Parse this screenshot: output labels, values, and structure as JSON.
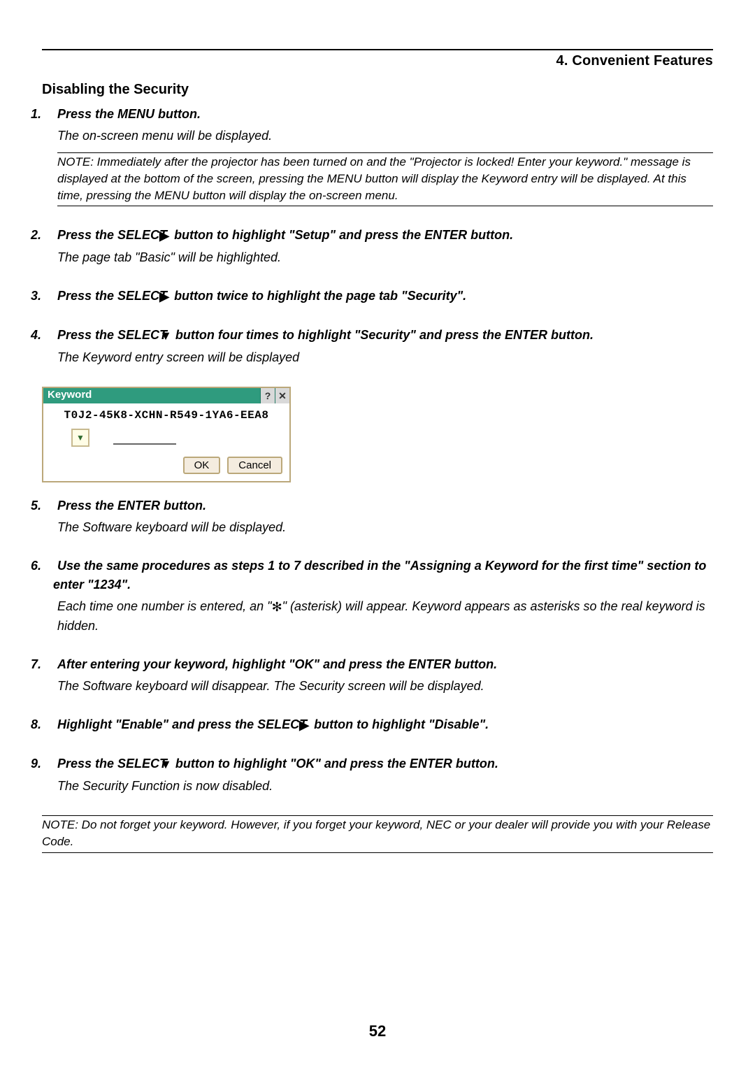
{
  "chapter": "4. Convenient Features",
  "section_title": "Disabling the Security",
  "glyphs": {
    "right": "▶",
    "down": "▼",
    "asterisk": "✻"
  },
  "steps": [
    {
      "num": "1.",
      "heading": "Press the MENU button.",
      "desc": "The on-screen menu will be displayed.",
      "note": "NOTE: Immediately after the projector has been turned on and the \"Projector is locked! Enter your keyword.\" message is displayed at the bottom of the screen, pressing the MENU button will display the Keyword entry will be displayed. At this time, pressing the MENU button will display the on-screen menu."
    },
    {
      "num": "2.",
      "heading_pre": "Press the SELECT ",
      "heading_glyph": "right",
      "heading_post": " button to highlight \"Setup\" and press the ENTER button.",
      "desc": "The page tab \"Basic\" will be highlighted."
    },
    {
      "num": "3.",
      "heading_pre": "Press the SELECT ",
      "heading_glyph": "right",
      "heading_post": " button twice to highlight the page tab \"Security\"."
    },
    {
      "num": "4.",
      "heading_pre": "Press the SELECT ",
      "heading_glyph": "down",
      "heading_post": " button four times to highlight \"Security\" and press the ENTER button.",
      "desc": "The Keyword entry screen will be displayed",
      "dialog": true
    },
    {
      "num": "5.",
      "heading": "Press the ENTER button.",
      "desc": "The Software keyboard will be displayed."
    },
    {
      "num": "6.",
      "heading": "Use the same procedures as steps 1 to 7 described in the \"Assigning a Keyword for the first time\" section to enter \"1234\".",
      "desc_pre": "Each time one number is entered, an \"",
      "desc_glyph": "asterisk",
      "desc_post": "\" (asterisk) will appear. Keyword appears as asterisks so the real keyword is hidden."
    },
    {
      "num": "7.",
      "heading": "After entering your keyword, highlight \"OK\" and press the ENTER button.",
      "desc": "The Software keyboard will disappear. The Security screen will be displayed."
    },
    {
      "num": "8.",
      "heading_pre": "Highlight \"Enable\" and press the SELECT ",
      "heading_glyph": "right",
      "heading_post": " button to highlight \"Disable\"."
    },
    {
      "num": "9.",
      "heading_pre": "Press the SELECT ",
      "heading_glyph": "down",
      "heading_post": " button to highlight \"OK\" and press the ENTER button.",
      "desc": "The Security Function is now disabled."
    }
  ],
  "final_note": "NOTE: Do not forget your keyword. However, if you forget your keyword, NEC or your dealer will provide you with your Release Code.",
  "dialog": {
    "title": "Keyword",
    "code": "T0J2-45K8-XCHN-R549-1YA6-EEA8",
    "ok": "OK",
    "cancel": "Cancel"
  },
  "page_number": "52"
}
